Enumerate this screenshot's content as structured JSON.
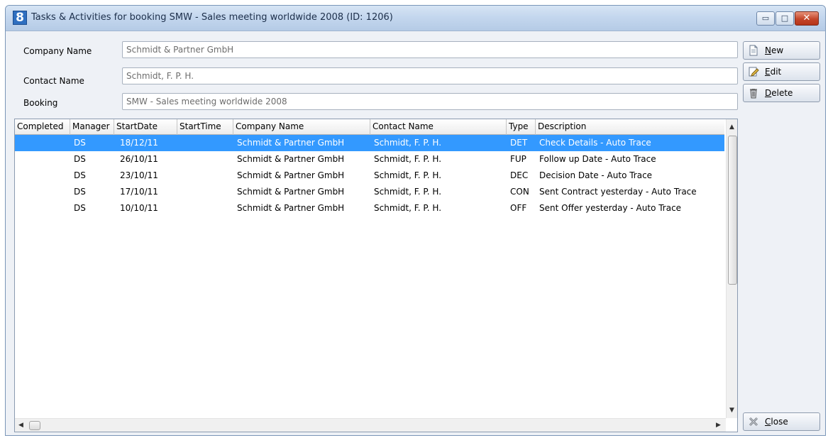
{
  "window": {
    "icon_text": "8",
    "title": "Tasks & Activities for booking SMW - Sales meeting worldwide 2008 (ID: 1206)",
    "controls": {
      "minimize": "▭",
      "maximize": "□",
      "close": "✕"
    }
  },
  "form": {
    "company_label": "Company Name",
    "company_value": "Schmidt & Partner GmbH",
    "contact_label": "Contact Name",
    "contact_value": "Schmidt, F. P. H.",
    "booking_label": "Booking",
    "booking_value": "SMW - Sales meeting worldwide 2008"
  },
  "grid": {
    "columns": [
      "Completed",
      "Manager",
      "StartDate",
      "StartTime",
      "Company Name",
      "Contact Name",
      "Type",
      "Description"
    ],
    "rows": [
      {
        "completed": "",
        "manager": "DS",
        "start_date": "18/12/11",
        "start_time": "",
        "company": "Schmidt & Partner GmbH",
        "contact": "Schmidt, F. P. H.",
        "type": "DET",
        "description": "Check Details - Auto Trace",
        "selected": true
      },
      {
        "completed": "",
        "manager": "DS",
        "start_date": "26/10/11",
        "start_time": "",
        "company": "Schmidt & Partner GmbH",
        "contact": "Schmidt, F. P. H.",
        "type": "FUP",
        "description": "Follow up Date - Auto Trace",
        "selected": false
      },
      {
        "completed": "",
        "manager": "DS",
        "start_date": "23/10/11",
        "start_time": "",
        "company": "Schmidt & Partner GmbH",
        "contact": "Schmidt, F. P. H.",
        "type": "DEC",
        "description": "Decision Date - Auto Trace",
        "selected": false
      },
      {
        "completed": "",
        "manager": "DS",
        "start_date": "17/10/11",
        "start_time": "",
        "company": "Schmidt & Partner GmbH",
        "contact": "Schmidt, F. P. H.",
        "type": "CON",
        "description": "Sent Contract yesterday - Auto Trace",
        "selected": false
      },
      {
        "completed": "",
        "manager": "DS",
        "start_date": "10/10/11",
        "start_time": "",
        "company": "Schmidt & Partner GmbH",
        "contact": "Schmidt, F. P. H.",
        "type": "OFF",
        "description": "Sent Offer yesterday - Auto Trace",
        "selected": false
      }
    ]
  },
  "buttons": {
    "new": "New",
    "edit": "Edit",
    "delete": "Delete",
    "close": "Close"
  },
  "icons": {
    "new": "new-document-icon",
    "edit": "edit-pencil-icon",
    "delete": "trash-icon",
    "close": "close-x-icon"
  }
}
